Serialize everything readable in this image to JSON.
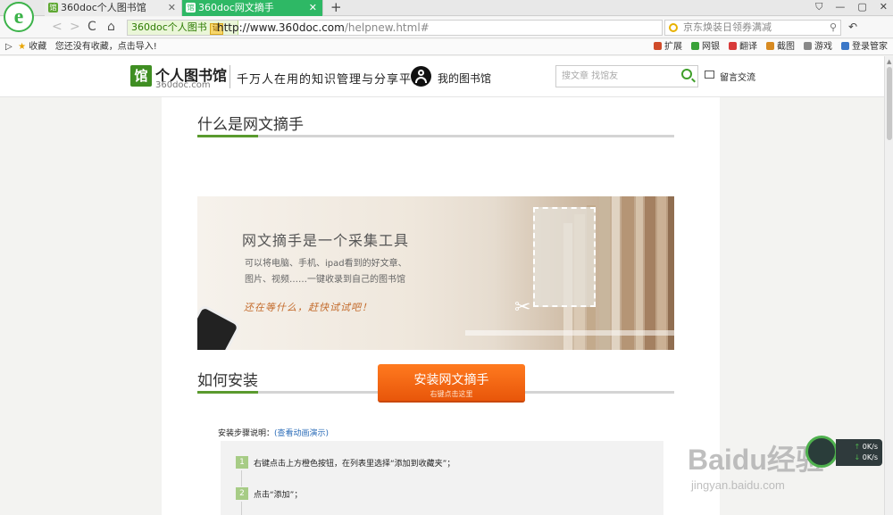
{
  "browser": {
    "logo_letter": "e",
    "tabs": [
      {
        "label": "360doc个人图书馆",
        "active": false
      },
      {
        "label": "360doc网文摘手",
        "active": true
      }
    ],
    "new_tab_symbol": "+",
    "window_controls": [
      "⛉",
      "—",
      "▢",
      "✕"
    ]
  },
  "addressbar": {
    "back": "<",
    "forward": ">",
    "reload": "C",
    "home": "⌂",
    "site_chip": "360doc个人图书",
    "cert_badge": "证",
    "url_domain": "http://www.360doc.com",
    "url_path": "/helpnew.html#",
    "search_placeholder": "京东焕装日领券满减",
    "undo": "↶"
  },
  "favbar": {
    "toggle": "▷",
    "favorites_label": "收藏",
    "import_hint": "您还没有收藏，点击导入!",
    "tools": [
      {
        "label": "扩展",
        "color": "#d04b2a"
      },
      {
        "label": "网银",
        "color": "#3aa23a"
      },
      {
        "label": "翻译",
        "color": "#d83a3a"
      },
      {
        "label": "截图",
        "color": "#d78a22"
      },
      {
        "label": "游戏",
        "color": "#888888"
      },
      {
        "label": "登录管家",
        "color": "#3a77c8"
      }
    ]
  },
  "site_header": {
    "logo_char": "馆",
    "logo_name": "个人图书馆",
    "logo_url": "360doc.com",
    "slogan": "千万人在用的知识管理与分享平台",
    "my_library": "我的图书馆",
    "search_placeholder": "搜文章 找馆友",
    "message_board": "留言交流"
  },
  "section1": {
    "title": "什么是网文摘手"
  },
  "banner": {
    "title": "网文摘手是一个采集工具",
    "desc_line1": "可以将电脑、手机、ipad看到的好文章、",
    "desc_line2": "图片、视频……一键收录到自己的图书馆",
    "slogan": "还在等什么，赶快试试吧！"
  },
  "section2": {
    "title": "如何安装"
  },
  "install_button": {
    "label": "安装网文摘手",
    "sub": "右键点击这里"
  },
  "steps": {
    "label": "安装步骤说明：",
    "demo_link": "(查看动画演示)",
    "items": [
      {
        "num": "1",
        "text": "右键点击上方橙色按钮，在列表里选择“添加到收藏夹”；"
      },
      {
        "num": "2",
        "text": "点击“添加”；"
      }
    ]
  },
  "speed_widget": {
    "up": "0K/s",
    "down": "0K/s"
  },
  "watermark": {
    "main": "Baidu经验",
    "sub": "jingyan.baidu.com"
  },
  "colors": {
    "accent_green": "#5a9a2e",
    "tab_active": "#2eb865",
    "install_orange": "#f2691a",
    "link_blue": "#2b6cb8"
  }
}
